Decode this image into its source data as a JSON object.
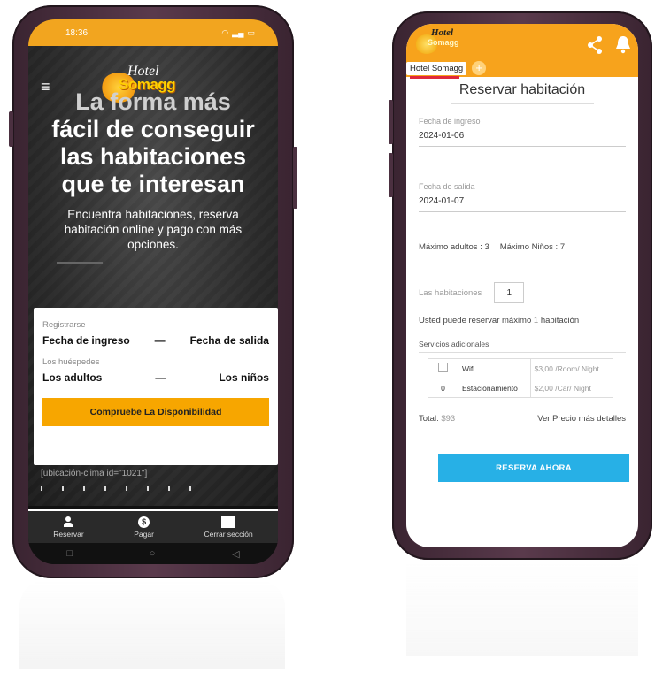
{
  "left_phone": {
    "status": {
      "time": "18:36"
    },
    "logo": {
      "hotel": "Hotel",
      "name": "Somagg"
    },
    "headline": {
      "line1": "La forma más",
      "line2": "fácil de conseguir",
      "line3": "las habitaciones",
      "line4": "que te interesan"
    },
    "subline": "Encuentra habitaciones, reserva habitación online y pago con más opciones.",
    "booking": {
      "register_label": "Registrarse",
      "checkin": "Fecha de ingreso",
      "dash1": "—",
      "checkout": "Fecha de salida",
      "guests_label": "Los huéspedes",
      "adults": "Los adultos",
      "dash2": "—",
      "children": "Los niños",
      "button": "Compruebe La Disponibilidad"
    },
    "shortcode": "[ubicación-clima id=\"1021\"]",
    "nav": [
      {
        "label": "Reservar",
        "icon": "person-icon"
      },
      {
        "label": "Pagar",
        "icon": "dollar-icon"
      },
      {
        "label": "Cerrar sección",
        "icon": "square-icon"
      }
    ],
    "sys_nav": {
      "recent": "□",
      "home": "○",
      "back": "◁"
    }
  },
  "right_phone": {
    "tab_label": "Hotel Somagg",
    "title": "Reservar habitación",
    "checkin_label": "Fecha de ingreso",
    "checkin_value": "2024-01-06",
    "checkout_label": "Fecha de salida",
    "checkout_value": "2024-01-07",
    "max_adults": "Máximo adultos : 3",
    "max_children": "Máximo Niños : 7",
    "rooms_label": "Las habitaciones",
    "rooms_value": "1",
    "can_reserve_pre": "Usted puede reservar máximo",
    "can_reserve_num": "1",
    "can_reserve_post": "habitación",
    "services_title": "Servicios adicionales",
    "services": [
      {
        "qty": "",
        "name": "Wifi",
        "price": "$3,00 /Room/ Night"
      },
      {
        "qty": "0",
        "name": "Estacionamiento",
        "price": "$2,00 /Car/ Night"
      }
    ],
    "total_label": "Total:",
    "total_value": "$93",
    "details_link": "Ver Precio más detalles",
    "reserve_button": "RESERVA AHORA"
  },
  "colors": {
    "accent_orange": "#f7a31c",
    "reserve_blue": "#27b0e6",
    "tab_red": "#e0283b"
  }
}
